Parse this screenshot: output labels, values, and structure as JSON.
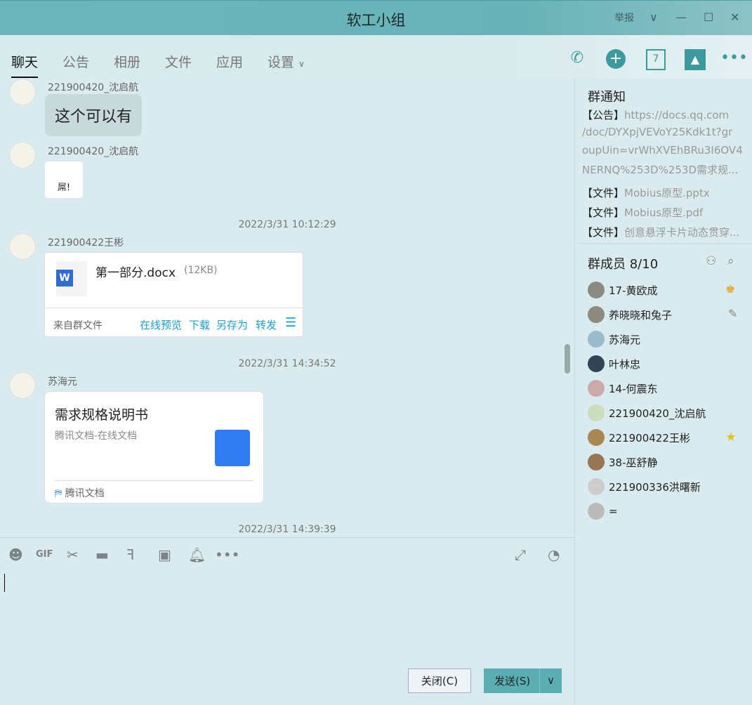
{
  "window": {
    "title": "软工小组",
    "report": "举报",
    "chevron": "∨",
    "minimize": "—",
    "maximize": "☐",
    "close": "✕"
  },
  "tabs": [
    "聊天",
    "公告",
    "相册",
    "文件",
    "应用",
    "设置"
  ],
  "messages": {
    "m1": {
      "sender": "221900420_沈启航",
      "text": "这个可以有"
    },
    "m2": {
      "sender": "221900420_沈启航",
      "sticker": "屌!"
    },
    "ts1": "2022/3/31 10:12:29",
    "m3": {
      "sender": "221900422王彬",
      "file_name": "第一部分.docx",
      "file_size": "(12KB)",
      "source": "来自群文件",
      "actions": [
        "在线预览",
        "下载",
        "另存为",
        "转发"
      ]
    },
    "ts2": "2022/3/31 14:34:52",
    "m4": {
      "sender": "苏海元",
      "doc_title": "需求规格说明书",
      "doc_sub": "腾讯文档-在线文档",
      "doc_brand": "腾讯文档"
    },
    "ts3": "2022/3/31 14:39:39"
  },
  "notice": {
    "title": "群通知",
    "items": [
      {
        "tag": "【公告】",
        "text": "https://docs.qq.com"
      },
      {
        "tag": "",
        "text": "/doc/DYXpjVEVoY25Kdk1t?gr"
      },
      {
        "tag": "",
        "text": "oupUin=vrWhXVEhBRu3I6OV4"
      },
      {
        "tag": "",
        "text": "NERNQ%253D%253D需求规..."
      },
      {
        "tag": "【文件】",
        "text": "Mobius原型.pptx"
      },
      {
        "tag": "【文件】",
        "text": "Mobius原型.pdf"
      },
      {
        "tag": "【文件】",
        "text": "创意悬浮卡片动态贯穿..."
      }
    ]
  },
  "members": {
    "title": "群成员 8/10",
    "list": [
      "17-黄欧成",
      "养晓晓和兔子",
      "苏海元",
      "叶林忠",
      "14-何震东",
      "221900420_沈启航",
      "221900422王彬",
      "38-巫舒静",
      "221900336洪曙新",
      "="
    ]
  },
  "footer": {
    "close": "关闭(C)",
    "send": "发送(S)"
  }
}
